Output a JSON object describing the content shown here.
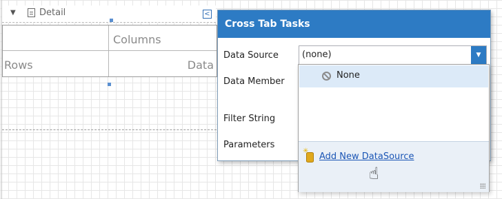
{
  "band": {
    "label": "Detail",
    "arrow_icon": "triangle-down-icon",
    "band_icon": "band-detail-icon"
  },
  "crosstab": {
    "columns_label": "Columns",
    "rows_label": "Rows",
    "data_label": "Data"
  },
  "smart_tag": {
    "icon": "chevron-left-icon",
    "glyph": "<"
  },
  "panel": {
    "title": "Cross Tab Tasks",
    "header_color": "#2d7bc4",
    "properties": {
      "data_source_label": "Data Source",
      "data_member_label": "Data Member",
      "filter_string_label": "Filter String",
      "parameters_label": "Parameters"
    },
    "data_source_value": "(none)",
    "dropdown_button_glyph": "▼"
  },
  "dropdown": {
    "items": [
      {
        "label": "None",
        "icon": "none-circle-icon",
        "selected": true
      }
    ],
    "add_link_label": "Add New DataSource",
    "add_icon": "add-datasource-icon",
    "cursor_icon": "hand-pointer-icon",
    "cursor_glyph": "☝"
  },
  "colors": {
    "accent": "#2d7bc4",
    "link": "#1a55b5",
    "selected_item": "#dceaf8",
    "footer_bg": "#eaf0f7"
  }
}
